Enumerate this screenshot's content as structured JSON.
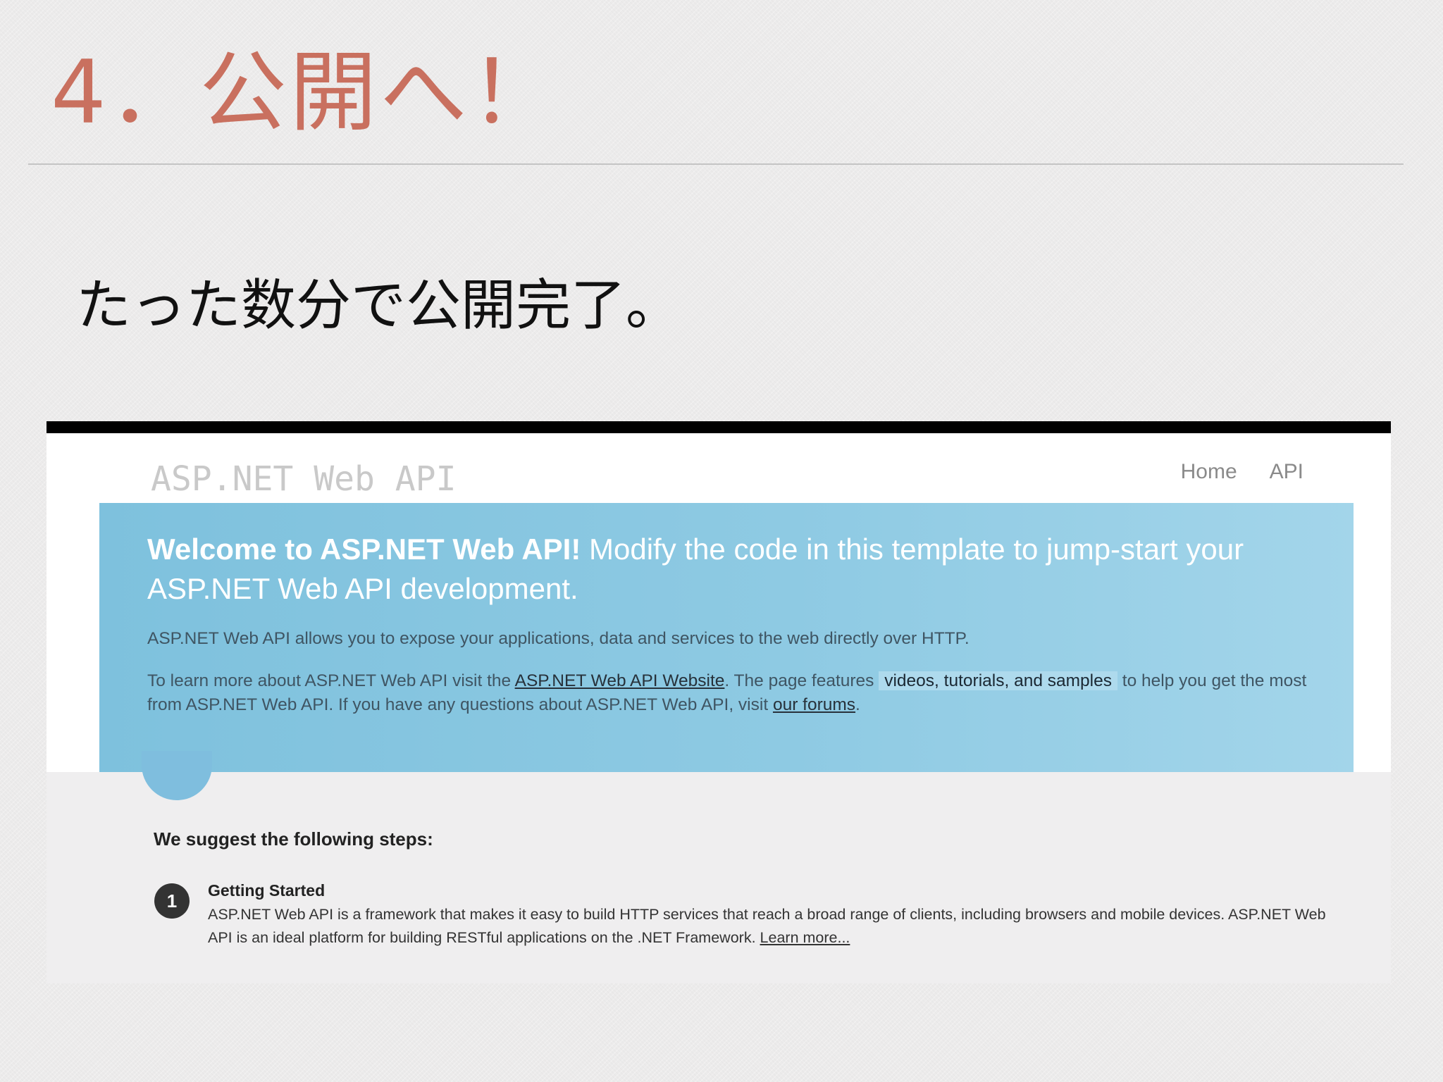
{
  "slide": {
    "title": "4．公開へ！",
    "body": "たった数分で公開完了。"
  },
  "colors": {
    "title": "#c9705f",
    "hero_start": "#7ec1dd",
    "hero_end": "#a3d5ea",
    "top_bar": "#000000"
  },
  "site": {
    "title": "ASP.NET Web API",
    "nav": [
      "Home",
      "API"
    ]
  },
  "hero": {
    "heading_bold": "Welcome to ASP.NET Web API!",
    "heading_rest": "Modify the code in this template to jump-start your ASP.NET Web API development.",
    "p1": "ASP.NET Web API allows you to expose your applications, data and services to the web directly over HTTP.",
    "p2_a": "To learn more about ASP.NET Web API visit the",
    "p2_link1": "ASP.NET Web API Website",
    "p2_b": ". The page features",
    "p2_highlight": "videos, tutorials, and samples",
    "p2_c": "to help you get the most from ASP.NET Web API. If you have any questions about ASP.NET Web API, visit",
    "p2_link2": "our forums",
    "p2_d": "."
  },
  "steps": {
    "heading": "We suggest the following steps:",
    "items": [
      {
        "number": "1",
        "title": "Getting Started",
        "desc": "ASP.NET Web API is a framework that makes it easy to build HTTP services that reach a broad range of clients, including browsers and mobile devices. ASP.NET Web API is an ideal platform for building RESTful applications on the .NET Framework.",
        "link": "Learn more..."
      }
    ]
  }
}
